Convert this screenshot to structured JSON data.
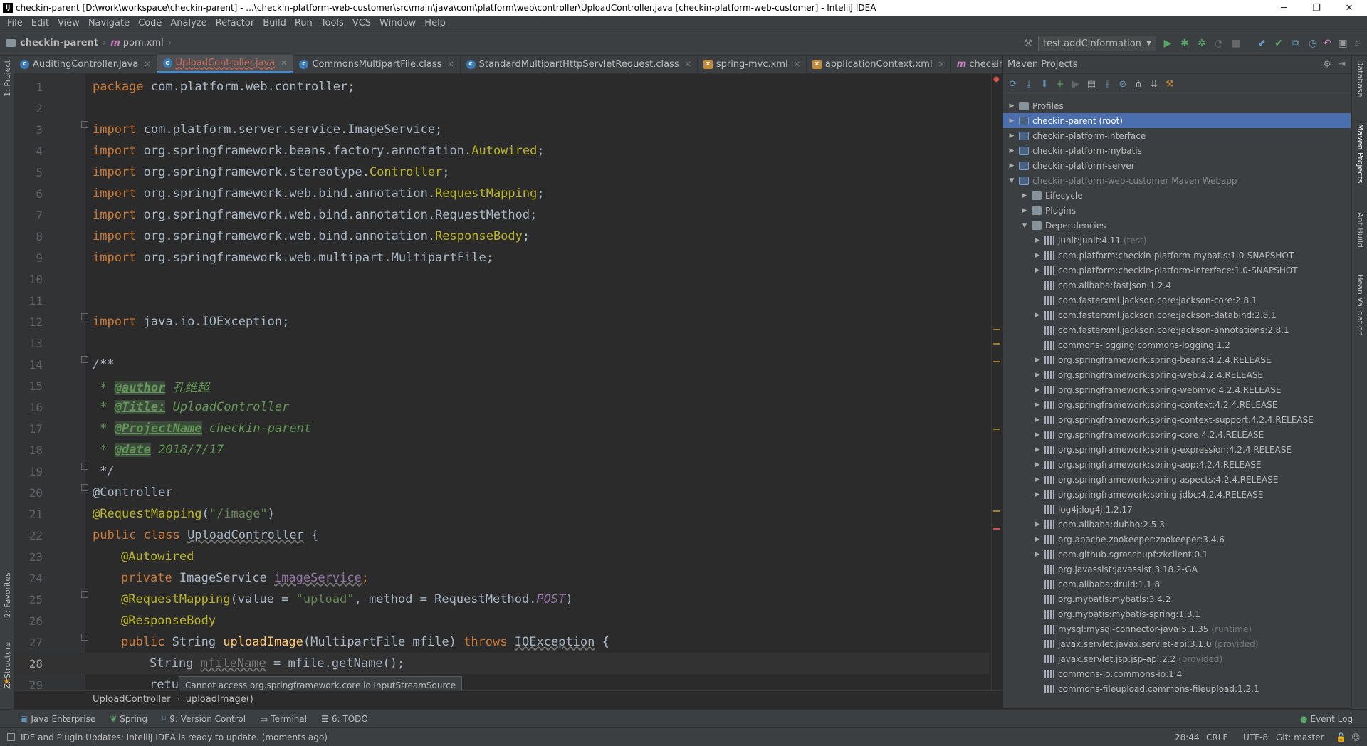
{
  "window": {
    "title": "checkin-parent [D:\\work\\workspace\\checkin-parent] - ...\\checkin-platform-web-customer\\src\\main\\java\\com\\platform\\web\\controller\\UploadController.java [checkin-platform-web-customer] - IntelliJ IDEA",
    "minimize": "─",
    "restore": "❐",
    "close": "✕"
  },
  "menu": [
    "File",
    "Edit",
    "View",
    "Navigate",
    "Code",
    "Analyze",
    "Refactor",
    "Build",
    "Run",
    "Tools",
    "VCS",
    "Window",
    "Help"
  ],
  "navbar": {
    "project": "checkin-parent",
    "file": "pom.xml",
    "run_config": "test.addCInformation"
  },
  "tabs": [
    {
      "label": "AuditingController.java",
      "color": "#bbbbbb",
      "icon_color": "#3a7ab8"
    },
    {
      "label": "UploadController.java",
      "color": "#d26a5b",
      "icon_color": "#3a7ab8"
    },
    {
      "label": "CommonsMultipartFile.class",
      "color": "#bbbbbb",
      "icon_color": "#3a7ab8"
    },
    {
      "label": "StandardMultipartHttpServletRequest.class",
      "color": "#bbbbbb",
      "icon_color": "#3a7ab8"
    },
    {
      "label": "spring-mvc.xml",
      "color": "#bbbbbb",
      "icon_color": "#c48a3a"
    },
    {
      "label": "applicationContext.xml",
      "color": "#bbbbbb",
      "icon_color": "#c48a3a"
    },
    {
      "label": "checkin-parent",
      "color": "#bbbbbb",
      "icon_color": "#7a5aa8"
    }
  ],
  "editor": {
    "line_numbers": [
      "1",
      "2",
      "3",
      "4",
      "5",
      "6",
      "7",
      "8",
      "9",
      "10",
      "11",
      "12",
      "13",
      "14",
      "15",
      "16",
      "17",
      "18",
      "19",
      "20",
      "21",
      "22",
      "23",
      "24",
      "25",
      "26",
      "27",
      "28",
      "29"
    ],
    "code": {
      "l1_kw": "package",
      "l1_rest": " com.platform.web.controller;",
      "import_kw": "import",
      "l3_pkg": " com.platform.server.service.ImageService;",
      "l4_pkg": " org.springframework.beans.factory.annotation.",
      "l4_cls": "Autowired",
      "l5_pkg": " org.springframework.stereotype.",
      "l5_cls": "Controller",
      "l6_pkg": " org.springframework.web.bind.annotation.",
      "l6_cls": "RequestMapping",
      "l7_pkg": " org.springframework.web.bind.annotation.RequestMethod;",
      "l8_pkg": " org.springframework.web.bind.annotation.",
      "l8_cls": "ResponseBody",
      "l9_pkg": " org.springframework.web.multipart.MultipartFile;",
      "l12_pkg": " java.io.IOException;",
      "semi": ";",
      "l14": "/**",
      "l15_tag": "@author",
      "l15_val": " 孔维超",
      "l16_tag": "@Title:",
      "l16_val": " UploadController",
      "l17_tag": "@ProjectName",
      "l17_val": " checkin-parent",
      "l18_tag": "@date",
      "l18_val": " 2018/7/17",
      "l19": " */",
      "star": " * ",
      "l20": "@Controller",
      "l21_ann": "@RequestMapping",
      "l21_open": "(",
      "l21_str": "\"/image\"",
      "l21_close": ")",
      "l22_kw": "public class ",
      "l22_cls": "UploadController",
      "l22_rest": " {",
      "l23": "@Autowired",
      "l24_kw": "private ",
      "l24_type": "ImageService ",
      "l24_fld": "imageService",
      "l25_ann": "@RequestMapping",
      "l25_a": "(value = ",
      "l25_str": "\"upload\"",
      "l25_b": ", method = RequestMethod.",
      "l25_post": "POST",
      "l25_c": ")",
      "l26": "@ResponseBody",
      "l27_kw": "public ",
      "l27_type": "String ",
      "l27_fn": "uploadImage",
      "l27_args": "(MultipartFile mfile) ",
      "l27_throws": "throws ",
      "l27_exc": "IOException",
      "l27_rest": " {",
      "l28_type": "String ",
      "l28_var": "mfileName",
      "l28_rest": " = mfile.getName();",
      "l29": "retu"
    }
  },
  "tooltip": "Cannot access org.springframework.core.io.InputStreamSource",
  "breadcrumb": [
    "UploadController",
    "uploadImage()"
  ],
  "maven": {
    "title": "Maven Projects",
    "tree": [
      {
        "label": "Profiles",
        "level": 0,
        "arrow": "▶",
        "icon": "prof"
      },
      {
        "label": "checkin-parent (root)",
        "level": 0,
        "arrow": "▶",
        "icon": "mod",
        "selected": true
      },
      {
        "label": "checkin-platform-interface",
        "level": 0,
        "arrow": "▶",
        "icon": "mod"
      },
      {
        "label": "checkin-platform-mybatis",
        "level": 0,
        "arrow": "▶",
        "icon": "mod"
      },
      {
        "label": "checkin-platform-server",
        "level": 0,
        "arrow": "▶",
        "icon": "mod"
      },
      {
        "label": "checkin-platform-web-customer Maven Webapp",
        "level": 0,
        "arrow": "▼",
        "icon": "mod",
        "dim": true
      },
      {
        "label": "Lifecycle",
        "level": 1,
        "arrow": "▶",
        "icon": "fold-ic"
      },
      {
        "label": "Plugins",
        "level": 1,
        "arrow": "▶",
        "icon": "fold-ic"
      },
      {
        "label": "Dependencies",
        "level": 1,
        "arrow": "▼",
        "icon": "fold-ic"
      },
      {
        "label": "junit:junit:4.11",
        "scope": "(test)",
        "level": 2,
        "arrow": "▶",
        "icon": "lib"
      },
      {
        "label": "com.platform:checkin-platform-mybatis:1.0-SNAPSHOT",
        "level": 2,
        "arrow": "▶",
        "icon": "lib"
      },
      {
        "label": "com.platform:checkin-platform-interface:1.0-SNAPSHOT",
        "level": 2,
        "arrow": "▶",
        "icon": "lib"
      },
      {
        "label": "com.alibaba:fastjson:1.2.4",
        "level": 2,
        "arrow": "",
        "icon": "lib"
      },
      {
        "label": "com.fasterxml.jackson.core:jackson-core:2.8.1",
        "level": 2,
        "arrow": "",
        "icon": "lib"
      },
      {
        "label": "com.fasterxml.jackson.core:jackson-databind:2.8.1",
        "level": 2,
        "arrow": "▶",
        "icon": "lib"
      },
      {
        "label": "com.fasterxml.jackson.core:jackson-annotations:2.8.1",
        "level": 2,
        "arrow": "",
        "icon": "lib"
      },
      {
        "label": "commons-logging:commons-logging:1.2",
        "level": 2,
        "arrow": "",
        "icon": "lib"
      },
      {
        "label": "org.springframework:spring-beans:4.2.4.RELEASE",
        "level": 2,
        "arrow": "▶",
        "icon": "lib"
      },
      {
        "label": "org.springframework:spring-web:4.2.4.RELEASE",
        "level": 2,
        "arrow": "▶",
        "icon": "lib"
      },
      {
        "label": "org.springframework:spring-webmvc:4.2.4.RELEASE",
        "level": 2,
        "arrow": "▶",
        "icon": "lib"
      },
      {
        "label": "org.springframework:spring-context:4.2.4.RELEASE",
        "level": 2,
        "arrow": "▶",
        "icon": "lib"
      },
      {
        "label": "org.springframework:spring-context-support:4.2.4.RELEASE",
        "level": 2,
        "arrow": "▶",
        "icon": "lib"
      },
      {
        "label": "org.springframework:spring-core:4.2.4.RELEASE",
        "level": 2,
        "arrow": "▶",
        "icon": "lib"
      },
      {
        "label": "org.springframework:spring-expression:4.2.4.RELEASE",
        "level": 2,
        "arrow": "▶",
        "icon": "lib"
      },
      {
        "label": "org.springframework:spring-aop:4.2.4.RELEASE",
        "level": 2,
        "arrow": "▶",
        "icon": "lib"
      },
      {
        "label": "org.springframework:spring-aspects:4.2.4.RELEASE",
        "level": 2,
        "arrow": "▶",
        "icon": "lib"
      },
      {
        "label": "org.springframework:spring-jdbc:4.2.4.RELEASE",
        "level": 2,
        "arrow": "▶",
        "icon": "lib"
      },
      {
        "label": "log4j:log4j:1.2.17",
        "level": 2,
        "arrow": "",
        "icon": "lib"
      },
      {
        "label": "com.alibaba:dubbo:2.5.3",
        "level": 2,
        "arrow": "▶",
        "icon": "lib"
      },
      {
        "label": "org.apache.zookeeper:zookeeper:3.4.6",
        "level": 2,
        "arrow": "▶",
        "icon": "lib"
      },
      {
        "label": "com.github.sgroschupf:zkclient:0.1",
        "level": 2,
        "arrow": "▶",
        "icon": "lib"
      },
      {
        "label": "org.javassist:javassist:3.18.2-GA",
        "level": 2,
        "arrow": "",
        "icon": "lib"
      },
      {
        "label": "com.alibaba:druid:1.1.8",
        "level": 2,
        "arrow": "",
        "icon": "lib"
      },
      {
        "label": "org.mybatis:mybatis:3.4.2",
        "level": 2,
        "arrow": "",
        "icon": "lib"
      },
      {
        "label": "org.mybatis:mybatis-spring:1.3.1",
        "level": 2,
        "arrow": "",
        "icon": "lib"
      },
      {
        "label": "mysql:mysql-connector-java:5.1.35",
        "scope": "(runtime)",
        "level": 2,
        "arrow": "",
        "icon": "lib"
      },
      {
        "label": "javax.servlet:javax.servlet-api:3.1.0",
        "scope": "(provided)",
        "level": 2,
        "arrow": "",
        "icon": "lib"
      },
      {
        "label": "javax.servlet.jsp:jsp-api:2.2",
        "scope": "(provided)",
        "level": 2,
        "arrow": "",
        "icon": "lib"
      },
      {
        "label": "commons-io:commons-io:1.4",
        "level": 2,
        "arrow": "",
        "icon": "lib"
      },
      {
        "label": "commons-fileupload:commons-fileupload:1.2.1",
        "level": 2,
        "arrow": "",
        "icon": "lib"
      }
    ]
  },
  "side_tools": {
    "left_top": "1: Project",
    "left_fav": "2: Favorites",
    "left_struct": "Z: Structure",
    "right": [
      "Database",
      "Maven Projects",
      "Ant Build",
      "Bean Validation"
    ]
  },
  "bottom_tools": [
    "Java Enterprise",
    "Spring",
    "9: Version Control",
    "Terminal",
    "6: TODO"
  ],
  "event_log": "Event Log",
  "status": {
    "message": "IDE and Plugin Updates: IntelliJ IDEA is ready to update. (moments ago)",
    "position": "28:44",
    "line_sep": "CRLF",
    "encoding": "UTF-8",
    "git": "Git: master"
  }
}
